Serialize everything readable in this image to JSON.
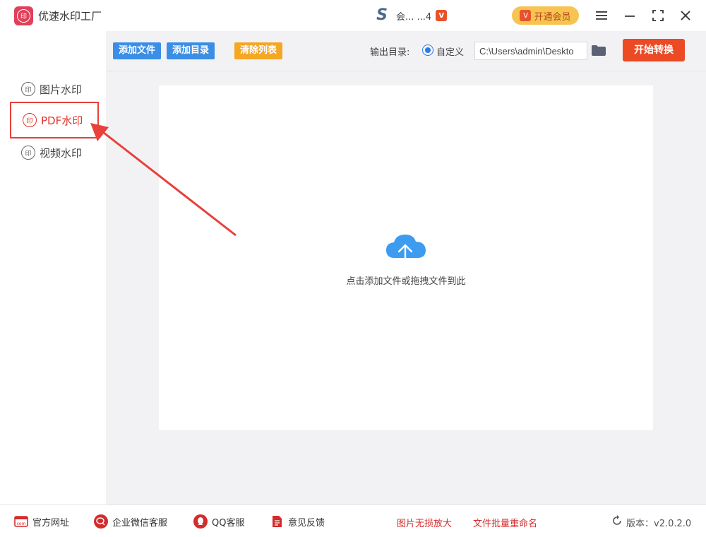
{
  "app": {
    "title": "优速水印工厂",
    "logo_text": "印"
  },
  "user": {
    "name": "会... ...4",
    "vip_mark": "V"
  },
  "header": {
    "vip_button": "开通会员"
  },
  "sidebar": {
    "items": [
      {
        "label": "图片水印",
        "icon": "印"
      },
      {
        "label": "PDF水印",
        "icon": "印"
      },
      {
        "label": "视频水印",
        "icon": "印"
      }
    ]
  },
  "toolbar": {
    "add_file": "添加文件",
    "add_dir": "添加目录",
    "clear_list": "清除列表",
    "output_label": "输出目录:",
    "custom_label": "自定义",
    "output_path": "C:\\Users\\admin\\Deskto",
    "start_button": "开始转换"
  },
  "dropzone": {
    "hint": "点击添加文件或拖拽文件到此"
  },
  "footer": {
    "website": "官方网址",
    "wechat_service": "企业微信客服",
    "qq_service": "QQ客服",
    "feedback": "意见反馈",
    "image_upscale": "图片无损放大",
    "batch_rename": "文件批量重命名",
    "version": "版本：v2.0.2.0",
    "website_icon_text": "com"
  },
  "colors": {
    "accent_blue": "#3a8ee6",
    "accent_orange": "#f5a623",
    "start_red": "#ec4a25",
    "highlight_red": "#e8403a"
  }
}
